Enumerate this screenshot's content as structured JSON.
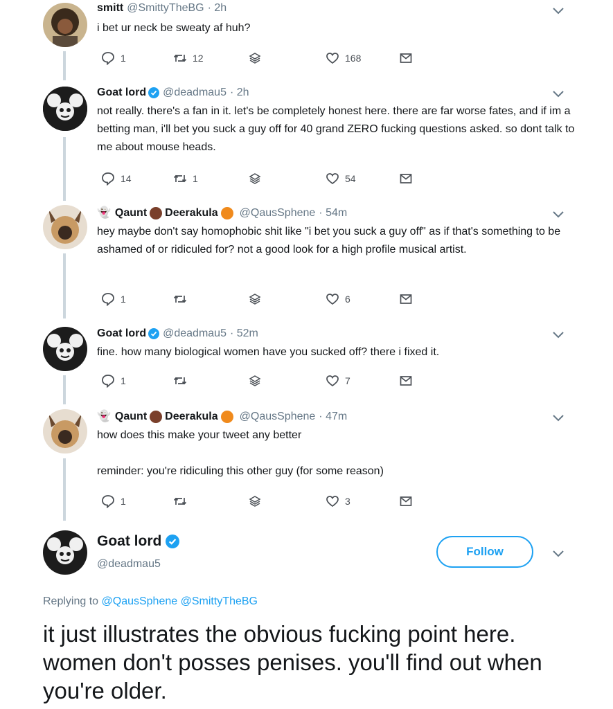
{
  "tweets": [
    {
      "name": "smitt",
      "handle": "@SmittyTheBG",
      "time": "· 2h",
      "text": "i bet ur neck be sweaty af huh?",
      "replies": "1",
      "retweets": "12",
      "likes": "168"
    },
    {
      "name": "Goat lord",
      "handle": "@deadmau5",
      "time": "· 2h",
      "text": "not really. there's a fan in it.  let's be completely honest here. there are far worse fates, and if  im a betting man, i'll bet you suck a guy off for 40 grand ZERO fucking questions asked. so dont talk to me about mouse heads.",
      "replies": "14",
      "retweets": "1",
      "likes": "54"
    },
    {
      "name_a": "Qaunt",
      "name_b": "Deerakula",
      "handle": "@QausSphene",
      "time": "· 54m",
      "text": "hey maybe don't say homophobic shit like \"i bet you suck a guy off\" as if that's something to be ashamed of or ridiculed for? not a good look for a high profile musical artist.",
      "replies": "1",
      "retweets": "",
      "likes": "6"
    },
    {
      "name": "Goat lord",
      "handle": "@deadmau5",
      "time": "· 52m",
      "text": "fine. how many biological women have you sucked off?  there i fixed it.",
      "replies": "1",
      "retweets": "",
      "likes": "7"
    },
    {
      "name_a": "Qaunt",
      "name_b": "Deerakula",
      "handle": "@QausSphene",
      "time": "· 47m",
      "text": "how does this make your tweet any better",
      "text2": "reminder: you're ridiculing this other guy (for some reason)",
      "replies": "1",
      "retweets": "",
      "likes": "3"
    }
  ],
  "main": {
    "name": "Goat lord",
    "handle": "@deadmau5",
    "follow_label": "Follow",
    "replying_prefix": "Replying to",
    "replying_to_1": "@QausSphene",
    "replying_to_2": "@SmittyTheBG",
    "text": "it just illustrates the obvious fucking point here.  women don't posses penises. you'll find out when you're older."
  },
  "colors": {
    "accent": "#1da1f2",
    "muted": "#657786",
    "verified": "#1da1f2"
  }
}
